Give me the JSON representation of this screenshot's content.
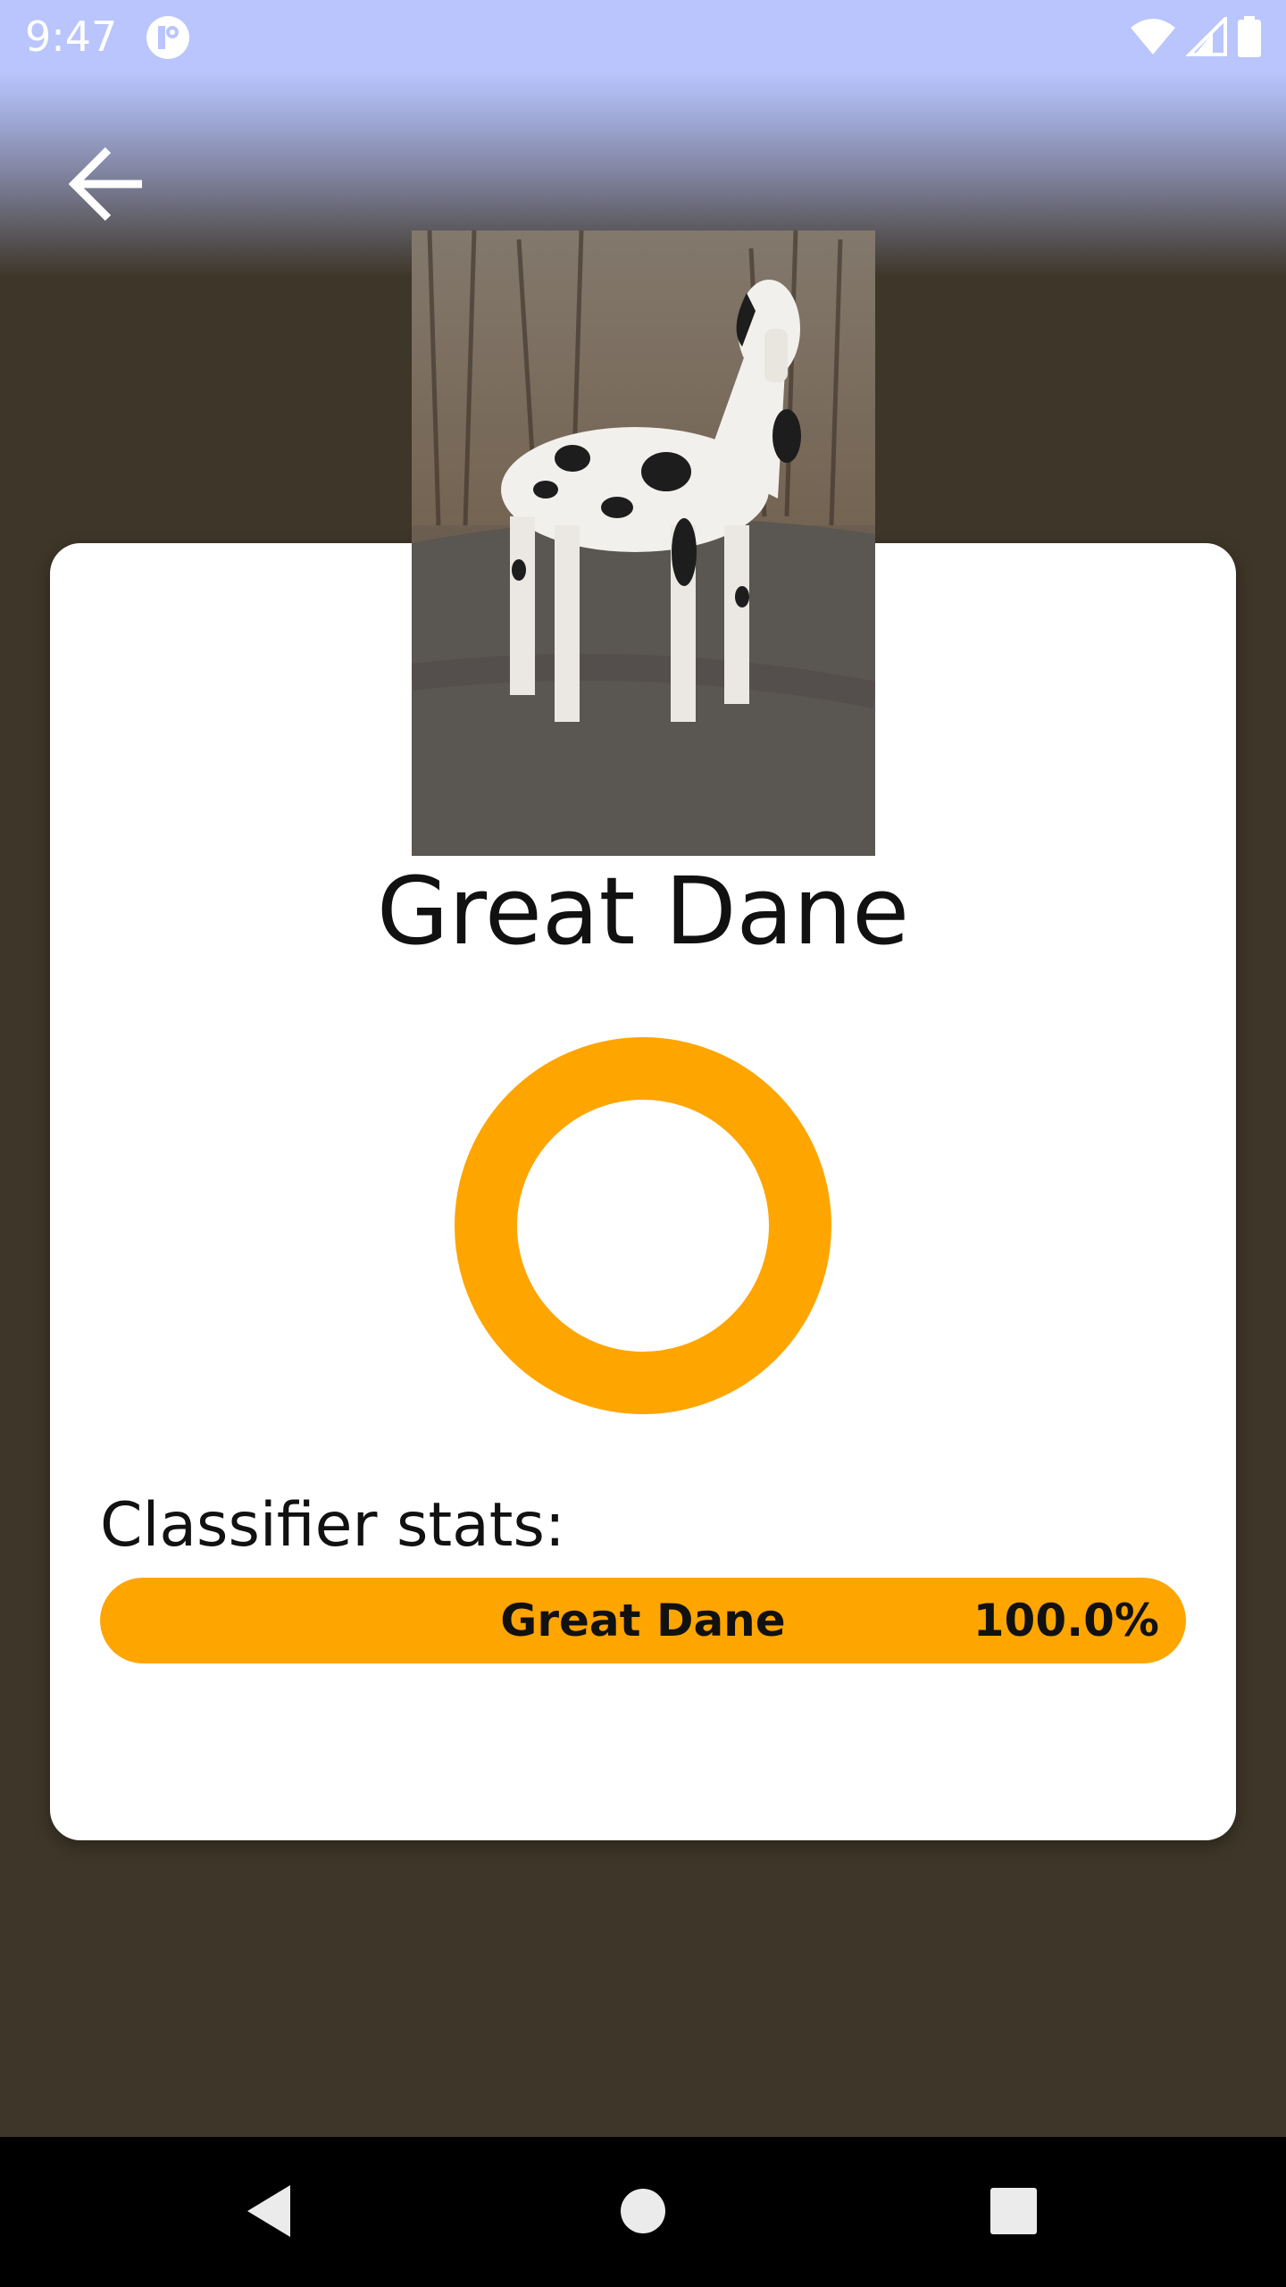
{
  "status_bar": {
    "time": "9:47",
    "app_icon": "app-notification-icon",
    "icons": [
      "wifi-icon",
      "cellular-signal-icon",
      "battery-icon"
    ]
  },
  "toolbar": {
    "back_icon": "arrow-back-icon"
  },
  "result": {
    "image_subject": "Great Dane dog photo",
    "breed_name": "Great Dane"
  },
  "ring_chart": {
    "color": "#ffa500",
    "track_color": "#ffffff",
    "confidence": 1.0
  },
  "stats": {
    "label": "Classifier stats:",
    "items": [
      {
        "label": "Great Dane",
        "value_text": "100.0%",
        "value": 100.0
      }
    ],
    "bar_color": "#ffa500"
  },
  "colors": {
    "background": "#3e3628",
    "header_tint": "#b9c5fc",
    "card": "#ffffff",
    "accent": "#ffa500"
  },
  "nav_bar": {
    "buttons": [
      "back-triangle-icon",
      "home-circle-icon",
      "recents-square-icon"
    ]
  }
}
